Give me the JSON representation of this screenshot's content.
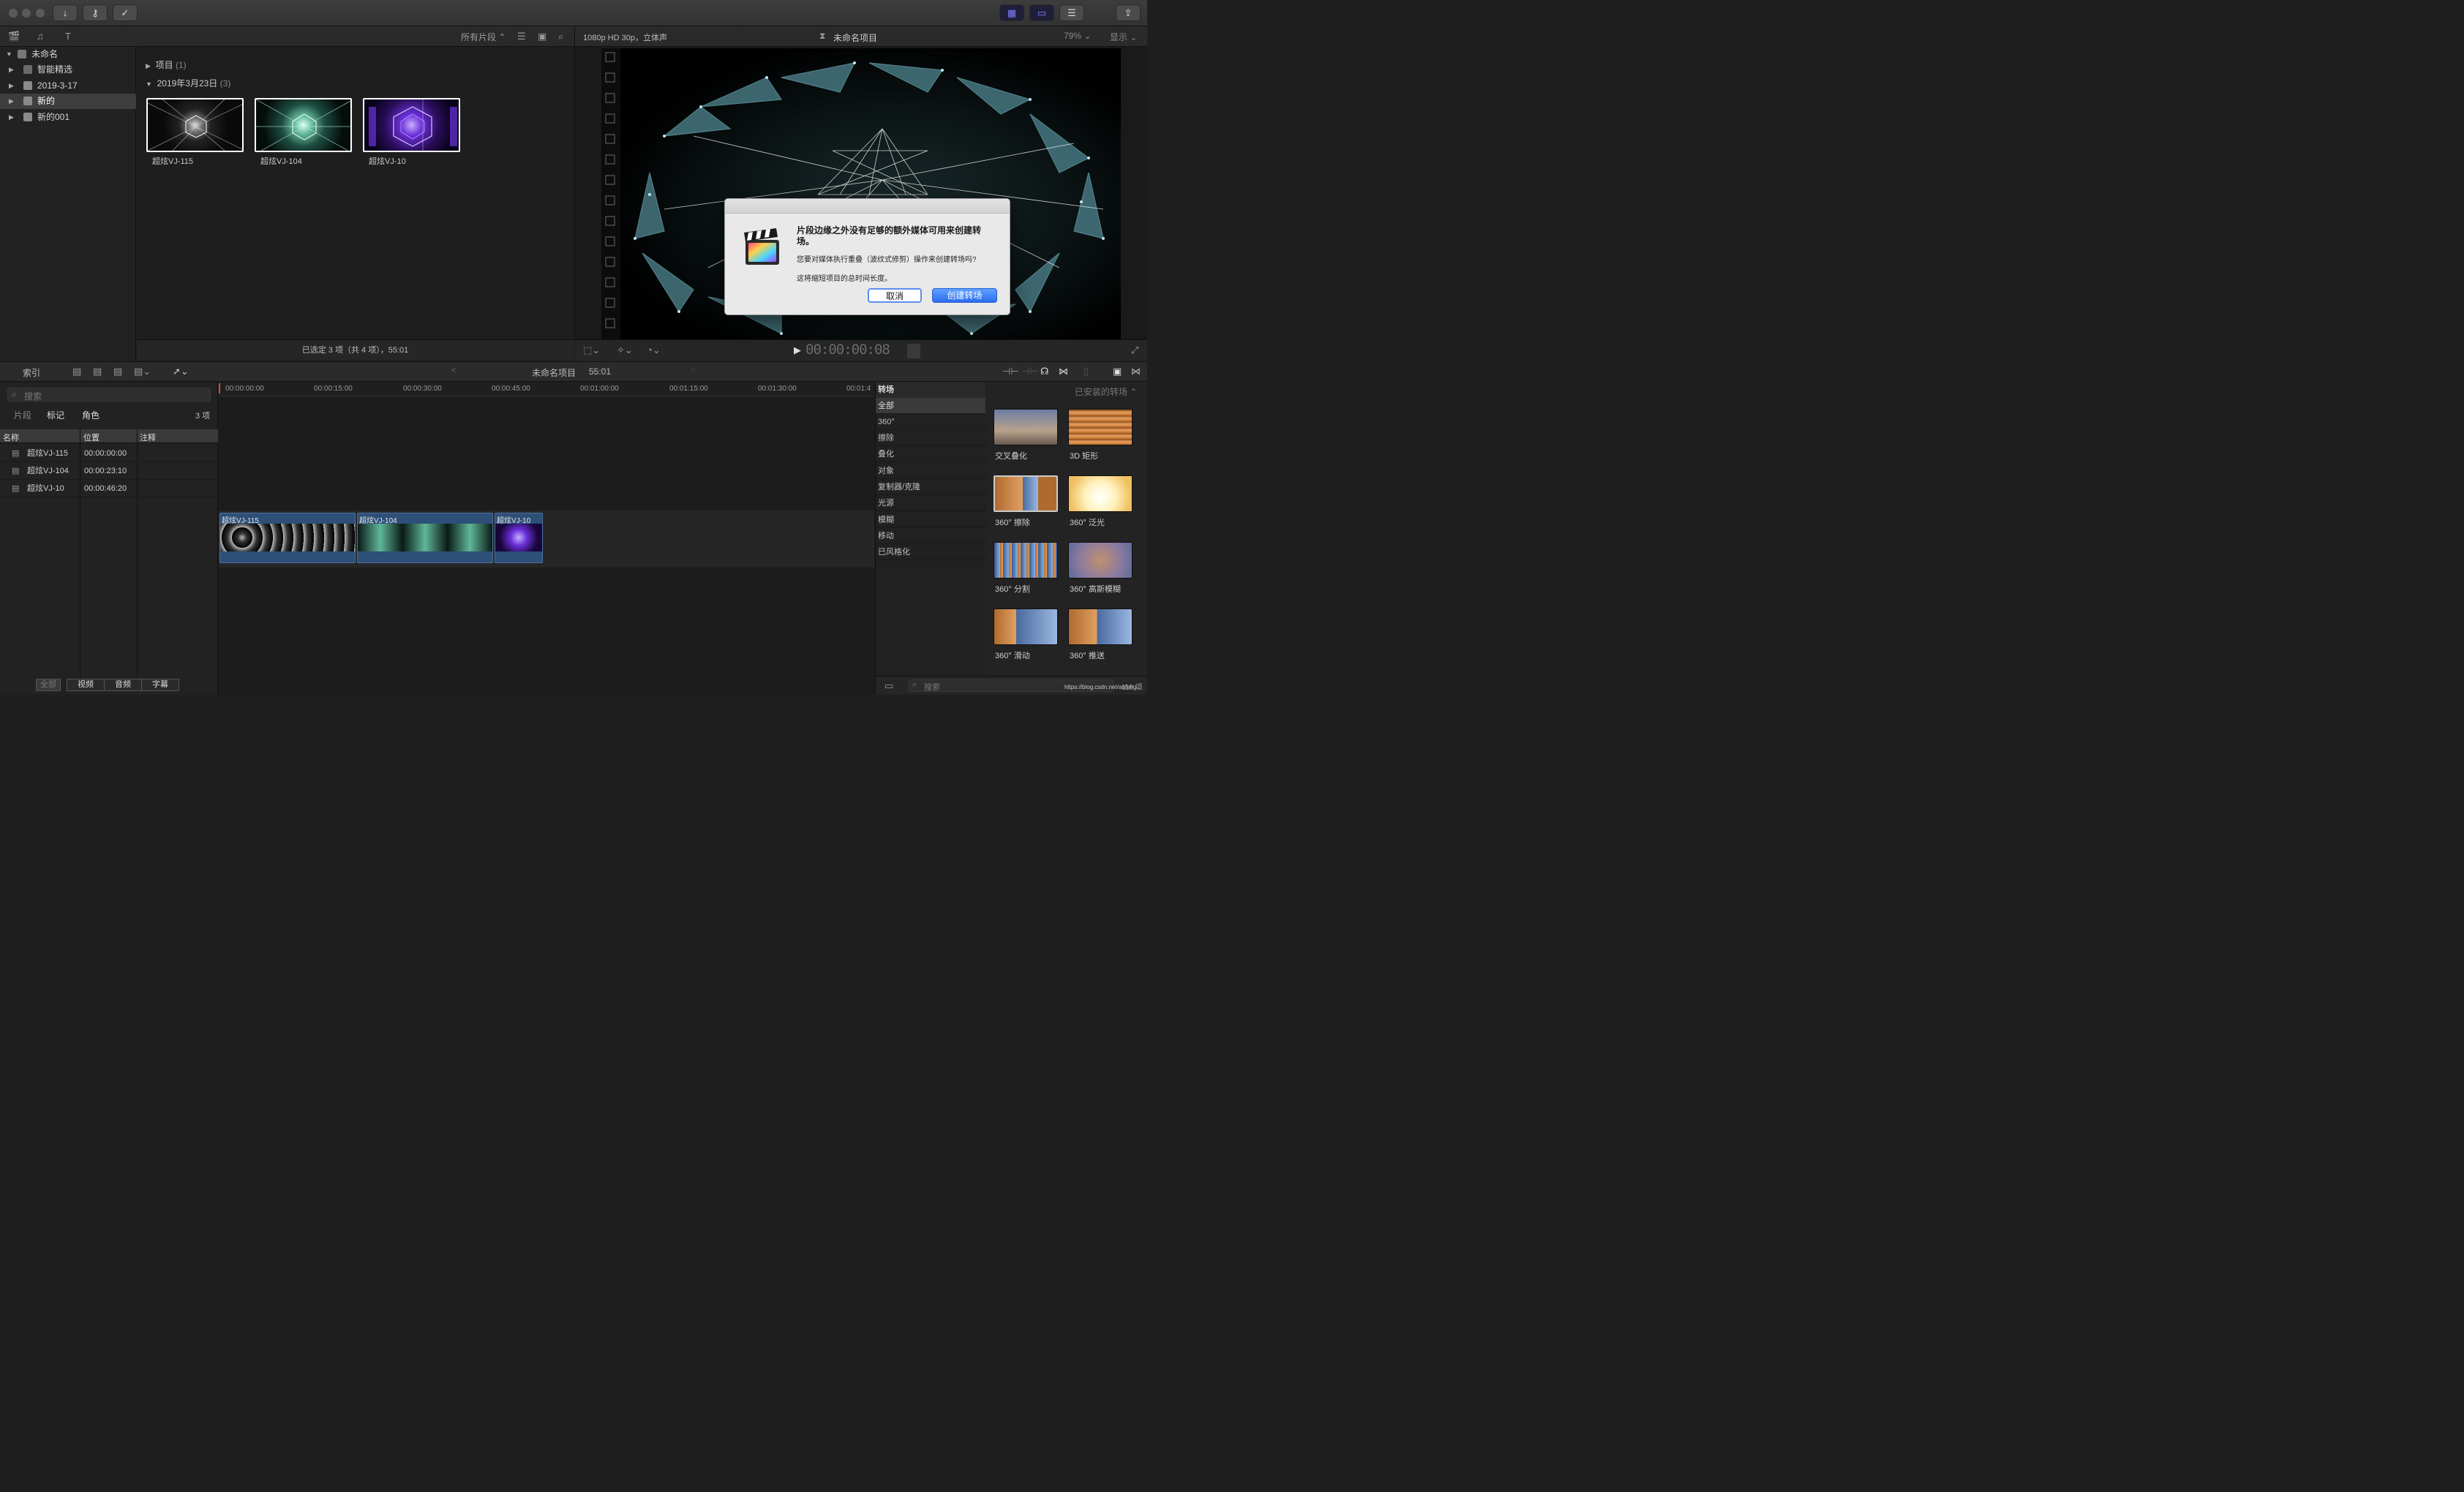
{
  "toolbar": {
    "buttons": [
      "import-icon",
      "key-icon",
      "check-icon"
    ]
  },
  "library": {
    "root": "未命名",
    "items": [
      "智能精选",
      "2019-3-17",
      "新的",
      "新的001"
    ],
    "selected_index": 2
  },
  "browser": {
    "filter_label": "所有片段",
    "group_project_label": "项目",
    "group_project_count": "(1)",
    "group_date_label": "2019年3月23日",
    "group_date_count": "(3)",
    "clips": [
      "超炫VJ-115",
      "超炫VJ-104",
      "超炫VJ-10"
    ],
    "status": "已选定 3 项（共 4 项），55:01"
  },
  "viewer": {
    "format": "1080p HD 30p，立体声",
    "project_title": "未命名项目",
    "zoom": "79%",
    "display_label": "显示",
    "timecode": "00:00:00:08"
  },
  "dialog": {
    "title": "片段边缘之外没有足够的额外媒体可用来创建转场。",
    "question": "您要对媒体执行重叠（波纹式修剪）操作来创建转场吗?",
    "note": "这将缩短项目的总时间长度。",
    "cancel_label": "取消",
    "confirm_label": "创建转场"
  },
  "timeline_header": {
    "index_label": "索引",
    "project_name": "未命名项目",
    "duration": "55:01"
  },
  "index": {
    "search_placeholder": "搜索",
    "tabs": [
      "片段",
      "标记",
      "角色"
    ],
    "count": "3 项",
    "columns": [
      "名称",
      "位置",
      "注释"
    ],
    "rows": [
      {
        "name": "超炫VJ-115",
        "pos": "00:00:00:00"
      },
      {
        "name": "超炫VJ-104",
        "pos": "00:00:23:10"
      },
      {
        "name": "超炫VJ-10",
        "pos": "00:00:46:20"
      }
    ],
    "filters": [
      "全部",
      "视频",
      "音频",
      "字幕"
    ]
  },
  "ruler": [
    "00:00:00:00",
    "00:00:15:00",
    "00:00:30:00",
    "00:00:45:00",
    "00:01:00:00",
    "00:01:15:00",
    "00:01:30:00",
    "00:01:4"
  ],
  "timeline_clips": [
    "超炫VJ-115",
    "超炫VJ-104",
    "超炫VJ-10"
  ],
  "transitions": {
    "title": "转场",
    "installed_label": "已安装的转场",
    "categories": [
      "全部",
      "360°",
      "擦除",
      "叠化",
      "对象",
      "复制器/克隆",
      "光源",
      "模糊",
      "移动",
      "已风格化"
    ],
    "items": [
      "交叉叠化",
      "3D 矩形",
      "360° 擦除",
      "360° 泛光",
      "360° 分割",
      "360° 高斯模糊",
      "360° 滑动",
      "360° 推送"
    ],
    "search_placeholder": "搜索",
    "count": "118 项",
    "watermark": "https://blog.csdn.net/anfeng..."
  }
}
